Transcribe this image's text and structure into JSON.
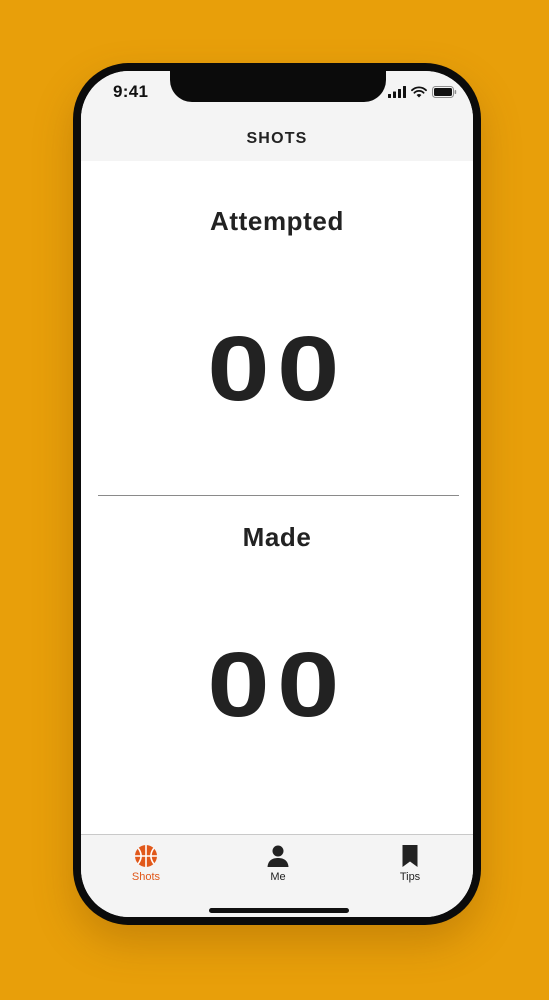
{
  "status_bar": {
    "time": "9:41",
    "icons": [
      "cellular-signal-icon",
      "wifi-icon",
      "battery-icon"
    ]
  },
  "header": {
    "title": "SHOTS"
  },
  "attempted": {
    "label": "Attempted",
    "value": "00"
  },
  "made": {
    "label": "Made",
    "value": "00"
  },
  "tab_bar": {
    "tabs": [
      {
        "label": "Shots",
        "icon": "basketball-icon",
        "active": true
      },
      {
        "label": "Me",
        "icon": "person-icon",
        "active": false
      },
      {
        "label": "Tips",
        "icon": "bookmark-icon",
        "active": false
      }
    ]
  },
  "colors": {
    "background": "#e89f0a",
    "accent": "#e1581a",
    "text": "#222222"
  }
}
